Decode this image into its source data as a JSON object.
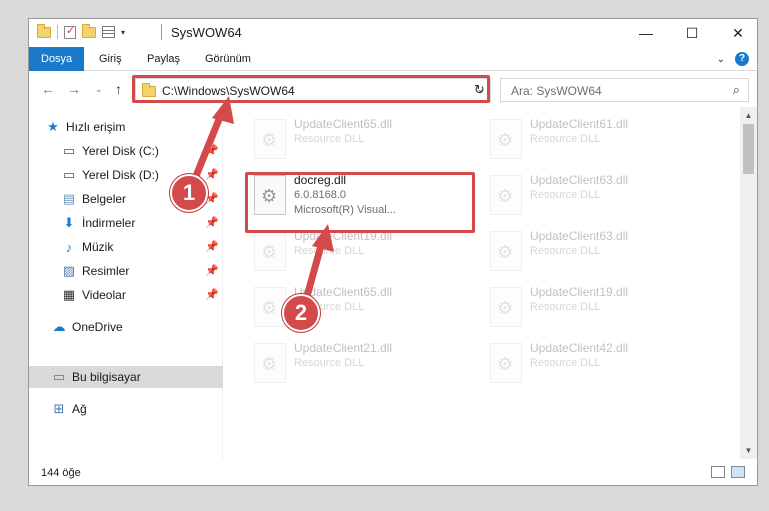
{
  "window": {
    "title": "SysWOW64",
    "minimize_glyph": "—",
    "maximize_glyph": "☐",
    "close_glyph": "✕"
  },
  "ribbon": {
    "tabs": [
      "Dosya",
      "Giriş",
      "Paylaş",
      "Görünüm"
    ],
    "active_tab": "Dosya",
    "accent": "#1979ca",
    "help": "?"
  },
  "nav": {
    "address": "C:\\Windows\\SysWOW64",
    "search_placeholder": "Ara: SysWOW64"
  },
  "sidebar": {
    "items": [
      {
        "label": "Hızlı erişim",
        "icon": "star-icon",
        "pinned": false
      },
      {
        "label": "Yerel Disk (C:)",
        "icon": "drive-icon",
        "pinned": true
      },
      {
        "label": "Yerel Disk (D:)",
        "icon": "drive-icon",
        "pinned": true
      },
      {
        "label": "Belgeler",
        "icon": "documents-icon",
        "pinned": true
      },
      {
        "label": "İndirmeler",
        "icon": "download-icon",
        "pinned": true
      },
      {
        "label": "Müzik",
        "icon": "music-icon",
        "pinned": true
      },
      {
        "label": "Resimler",
        "icon": "pictures-icon",
        "pinned": true
      },
      {
        "label": "Videolar",
        "icon": "video-icon",
        "pinned": true
      },
      {
        "label": "OneDrive",
        "icon": "cloud-icon",
        "pinned": false
      },
      {
        "label": "Bu bilgisayar",
        "icon": "computer-icon",
        "pinned": false,
        "selected": true
      },
      {
        "label": "Ağ",
        "icon": "network-icon",
        "pinned": false
      }
    ]
  },
  "files": {
    "highlighted": {
      "name": "docreg.dll",
      "version": "6.0.8168.0",
      "company": "Microsoft(R) Visual..."
    },
    "faded_left": [
      {
        "name": "UpdateClient65.dll",
        "type": "Resource DLL"
      },
      {
        "name": "UpdateClient19.dll",
        "type": "Resource DLL"
      },
      {
        "name": "UpdateClient65.dll",
        "type": "Resource DLL"
      },
      {
        "name": "UpdateClient21.dll",
        "type": "Resource DLL"
      }
    ],
    "faded_right": [
      {
        "name": "UpdateClient61.dll",
        "type": "Resource DLL"
      },
      {
        "name": "UpdateClient63.dll",
        "type": "Resource DLL"
      },
      {
        "name": "UpdateClient63.dll",
        "type": "Resource DLL"
      },
      {
        "name": "UpdateClient19.dll",
        "type": "Resource DLL"
      },
      {
        "name": "UpdateClient42.dll",
        "type": "Resource DLL"
      }
    ]
  },
  "status": {
    "count": "144 öğe"
  },
  "annotations": {
    "badge_1": "1",
    "badge_2": "2",
    "color": "#d44a4a"
  }
}
